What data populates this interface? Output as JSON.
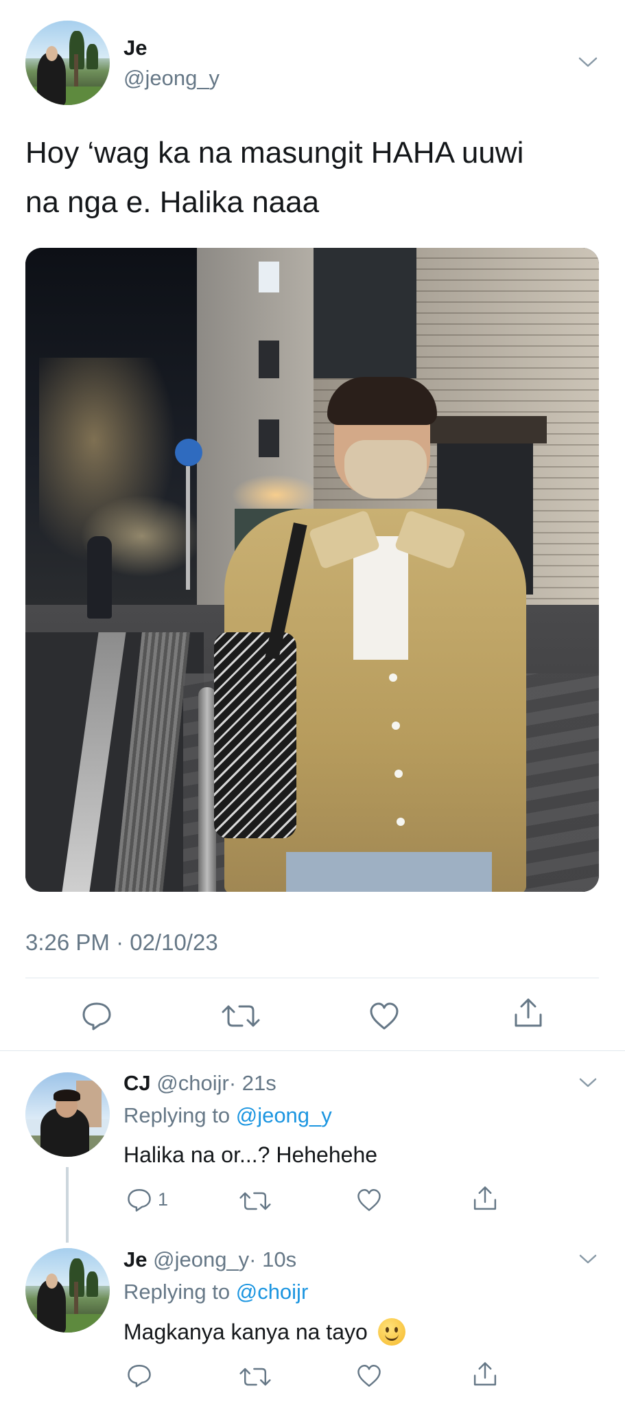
{
  "main_tweet": {
    "author_name": "Je",
    "author_handle": "@jeong_y",
    "text_line1": "Hoy ‘wag ka na masungit HAHA uuwi",
    "text_line2": "na nga e. Halika naaa",
    "timestamp": "3:26 PM · 02/10/23",
    "avatar_icon": "profile-photo-icon",
    "actions": [
      "reply-icon",
      "retweet-icon",
      "like-icon",
      "share-icon"
    ]
  },
  "replies": [
    {
      "author_name": "CJ",
      "author_handle": "@choijr",
      "time": "· 21s",
      "replying_prefix": "Replying to",
      "replying_to": "@jeong_y",
      "text": "Halika na or...? Hehehehe",
      "reply_count": "1"
    },
    {
      "author_name": "Je",
      "author_handle": "@jeong_y",
      "time": "· 10s",
      "replying_prefix": "Replying to",
      "replying_to": "@choijr",
      "text": "Magkanya kanya na tayo",
      "emoji": "🙂",
      "reply_count": ""
    }
  ],
  "colors": {
    "link": "#1b95e0",
    "muted": "#657786",
    "text": "#14171a",
    "divider": "#e1e8ed"
  }
}
